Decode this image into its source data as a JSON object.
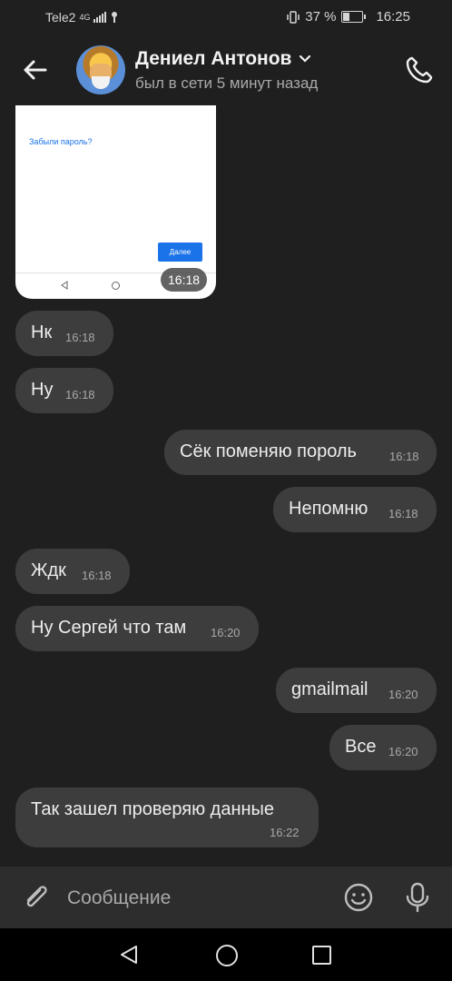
{
  "status_bar": {
    "carrier": "Tele2",
    "network": "4G",
    "battery_percent": "37 %",
    "time": "16:25"
  },
  "header": {
    "name": "Дениел Антонов",
    "status": "был в сети 5 минут назад"
  },
  "image_message": {
    "link_text": "Забыли пароль?",
    "button_text": "Далее",
    "time": "16:18"
  },
  "messages": [
    {
      "side": "in",
      "text": "Нк",
      "time": "16:18"
    },
    {
      "side": "in",
      "text": "Ну",
      "time": "16:18"
    },
    {
      "side": "out",
      "text": "Сёк поменяю пороль",
      "time": "16:18"
    },
    {
      "side": "out",
      "text": "Непомню",
      "time": "16:18"
    },
    {
      "side": "in",
      "text": "Ждк",
      "time": "16:18"
    },
    {
      "side": "in",
      "text": "Ну Сергей что там",
      "time": "16:20"
    },
    {
      "side": "out",
      "text": "gmailmail",
      "time": "16:20"
    },
    {
      "side": "out",
      "text": "Все",
      "time": "16:20"
    },
    {
      "side": "in",
      "text": "Так зашел проверяю данные",
      "time": "16:22"
    }
  ],
  "composer": {
    "placeholder": "Сообщение"
  }
}
